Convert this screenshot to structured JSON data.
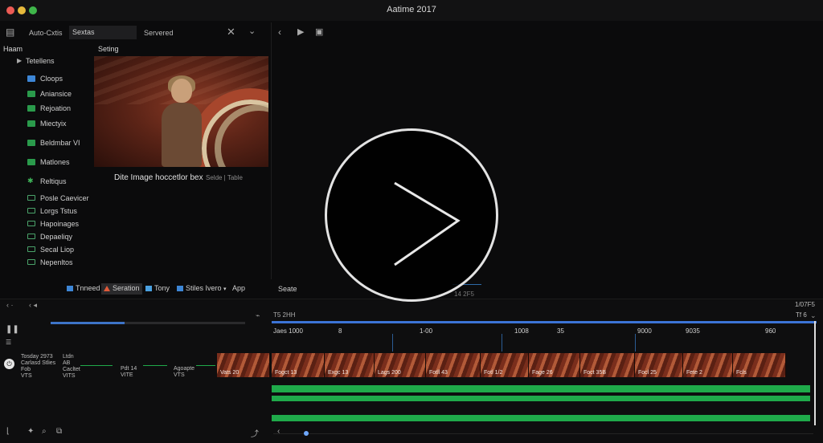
{
  "window": {
    "title": "Aatime 2017"
  },
  "toolbar": {
    "auto_label": "Auto-Cxtis",
    "field_value": "Sextas",
    "served_label": "Servered"
  },
  "panels": {
    "left_head": "Haam",
    "settings_head": "Seting",
    "group_label": "Tetellens"
  },
  "sidebar": {
    "items": [
      {
        "label": "Cloops",
        "icon": "blue-square-icon"
      },
      {
        "label": "Aniansice",
        "icon": "green-square-icon"
      },
      {
        "label": "Rejoation",
        "icon": "green-square-icon"
      },
      {
        "label": "Miectyix",
        "icon": "green-square-icon"
      },
      {
        "label": "Beldmbar VI",
        "icon": "green-square-icon"
      },
      {
        "label": "Matlones",
        "icon": "green-square-icon"
      },
      {
        "label": "Reltiqus",
        "icon": "sparkle-icon"
      },
      {
        "label": "Posle Caevicer",
        "icon": "folder-icon"
      },
      {
        "label": "Lorgs Tstus",
        "icon": "folder-icon"
      },
      {
        "label": "Hapoinages",
        "icon": "folder-icon"
      },
      {
        "label": "Depaeliqy",
        "icon": "folder-icon"
      },
      {
        "label": "Secal Liop",
        "icon": "folder-icon"
      },
      {
        "label": "Nepenltos",
        "icon": "folder-icon"
      }
    ]
  },
  "preview": {
    "caption": "Dite Image hoccetlor bex",
    "sub": "Selde | Table"
  },
  "tabs": [
    {
      "label": "Tnneed",
      "color": "#3d86d6"
    },
    {
      "label": "Seration",
      "color": "#e05a3a"
    },
    {
      "label": "Tony",
      "color": "#4aa0e0"
    },
    {
      "label": "Stiles Ivero",
      "color": "#3d86d6"
    },
    {
      "label": "App",
      "color": ""
    }
  ],
  "viewer": {
    "label": "Seate",
    "time_ghost": "14 2F5",
    "right_counter": "1/07F5",
    "right_counter2": "Tf 6"
  },
  "timeline": {
    "left_time": "T5 2HH",
    "left_progress": 0.38,
    "ruler": [
      "Jaes 1000",
      "8",
      "1-00",
      "1008",
      "35",
      "9000",
      "9035",
      "960"
    ],
    "clips_left": [
      {
        "label": "Vats 20"
      }
    ],
    "clips": [
      {
        "label": "Fogct 13"
      },
      {
        "label": "Exgc 13"
      },
      {
        "label": "Lags 200"
      },
      {
        "label": "Fotll 43"
      },
      {
        "label": "Fotl 1/2"
      },
      {
        "label": "Fage 26"
      },
      {
        "label": "Foct 35B"
      },
      {
        "label": "Focl 25"
      },
      {
        "label": "Fete 2"
      },
      {
        "label": "Fcls"
      }
    ],
    "track_info": [
      {
        "text": "Tosday 2973\nCarlasd Stlies\nFob\nVTS"
      },
      {
        "text": "Ltdn\nAB\nCacltet\nVITS"
      },
      {
        "text": "Pdt 14\nVITE"
      },
      {
        "text": "Agoapte\nVTS"
      }
    ]
  }
}
